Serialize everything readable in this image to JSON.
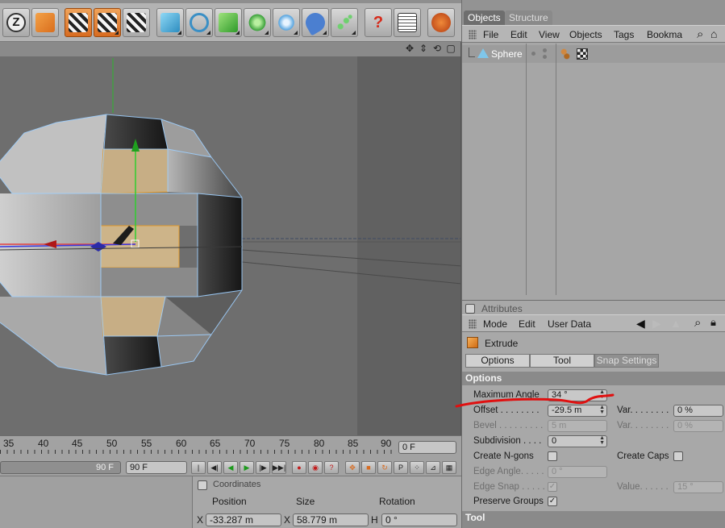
{
  "toolbar": {
    "buttons": [
      {
        "name": "undo-z-icon"
      },
      {
        "name": "move-arrow-icon"
      },
      {
        "name": "render-view-clapper-icon"
      },
      {
        "name": "render-picture-viewer-icon"
      },
      {
        "name": "render-settings-icon"
      },
      {
        "name": "cube-primitive-icon"
      },
      {
        "name": "spline-icon"
      },
      {
        "name": "nurbs-icon"
      },
      {
        "name": "array-cloner-icon"
      },
      {
        "name": "deformer-icon"
      },
      {
        "name": "camera-icon"
      },
      {
        "name": "particle-icon"
      },
      {
        "name": "help-question-icon"
      },
      {
        "name": "calendar-layout-icon"
      },
      {
        "name": "globe-icon"
      }
    ]
  },
  "timeline": {
    "ticks": [
      "35",
      "40",
      "45",
      "50",
      "55",
      "60",
      "65",
      "70",
      "75",
      "80",
      "85",
      "90"
    ],
    "current_frame": "0 F",
    "end_frame_a": "90 F",
    "end_frame_b": "90 F"
  },
  "coordinates": {
    "title": "Coordinates",
    "col_position": "Position",
    "col_size": "Size",
    "col_rotation": "Rotation",
    "axis_x": "X",
    "axis_h": "H",
    "pos_x": "-33.287 m",
    "size_x": "58.779 m",
    "rot_h": "0 °"
  },
  "objects": {
    "tab_objects": "Objects",
    "tab_structure": "Structure",
    "menu": [
      "File",
      "Edit",
      "View",
      "Objects",
      "Tags",
      "Bookma"
    ],
    "items": [
      {
        "label": "Sphere"
      }
    ]
  },
  "attributes": {
    "title": "Attributes",
    "menu": [
      "Mode",
      "Edit",
      "User Data"
    ],
    "tool_name": "Extrude",
    "tabs": [
      "Options",
      "Tool",
      "Snap Settings"
    ],
    "options_header": "Options",
    "tool_header": "Tool",
    "max_angle_label": "Maximum Angle",
    "max_angle_value": "34 °",
    "offset_label": "Offset . . . . . . . .",
    "offset_value": "-29.5 m",
    "var_label_1": "Var. . . . . . . .",
    "var_value_1": "0 %",
    "bevel_label": "Bevel . . . . . . . . .",
    "bevel_value": "5 m",
    "var_label_2": "Var. . . . . . . .",
    "var_value_2": "0 %",
    "subdivision_label": "Subdivision . . . .",
    "subdivision_value": "0",
    "create_ngons_label": "Create N-gons",
    "create_caps_label": "Create Caps",
    "edge_angle_label": "Edge Angle. . . . .",
    "edge_angle_value": "0 °",
    "edge_snap_label": "Edge Snap . . . . .",
    "value_label": "Value. . . . . .",
    "value_value": "15 °",
    "preserve_groups_label": "Preserve Groups"
  },
  "colors": {
    "highlight_orange": "#d86b20",
    "annotation_red": "#e01010",
    "face_selected": "#c7ae85",
    "edge_blue": "#8fc7ff"
  }
}
